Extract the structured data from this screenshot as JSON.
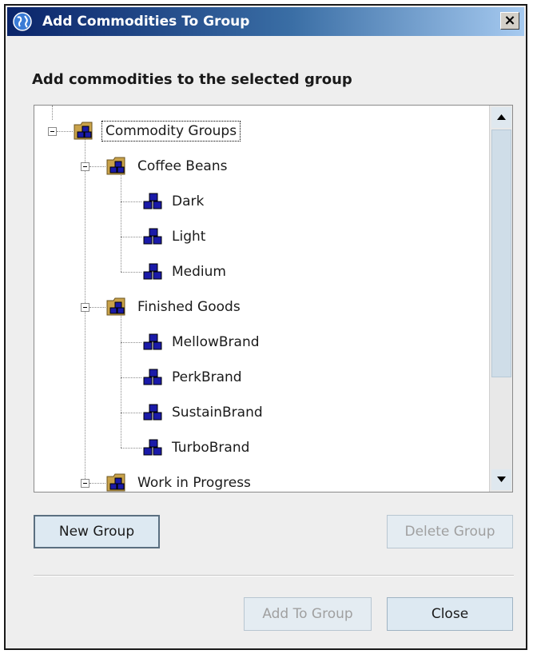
{
  "window": {
    "title": "Add Commodities To Group",
    "close_glyph": "×"
  },
  "heading": "Add commodities to the selected group",
  "tree": {
    "root": "Commodity Groups",
    "groups": [
      {
        "label": "Coffee Beans",
        "children": [
          "Dark",
          "Light",
          "Medium"
        ]
      },
      {
        "label": "Finished Goods",
        "children": [
          "MellowBrand",
          "PerkBrand",
          "SustainBrand",
          "TurboBrand"
        ]
      },
      {
        "label": "Work in Progress",
        "children": []
      }
    ]
  },
  "buttons": {
    "new_group": "New Group",
    "delete_group": "Delete Group",
    "add_to_group": "Add To Group",
    "close": "Close"
  },
  "icons": {
    "title": "globe-icon",
    "group": "folder-cubes-icon",
    "commodity": "cubes-icon"
  },
  "colors": {
    "title_gradient_start": "#0a246a",
    "title_gradient_end": "#a6caf0",
    "icon_blue": "#1a1aa8",
    "button_bg": "#dde9f2",
    "disabled_text": "#a0a0a0"
  }
}
